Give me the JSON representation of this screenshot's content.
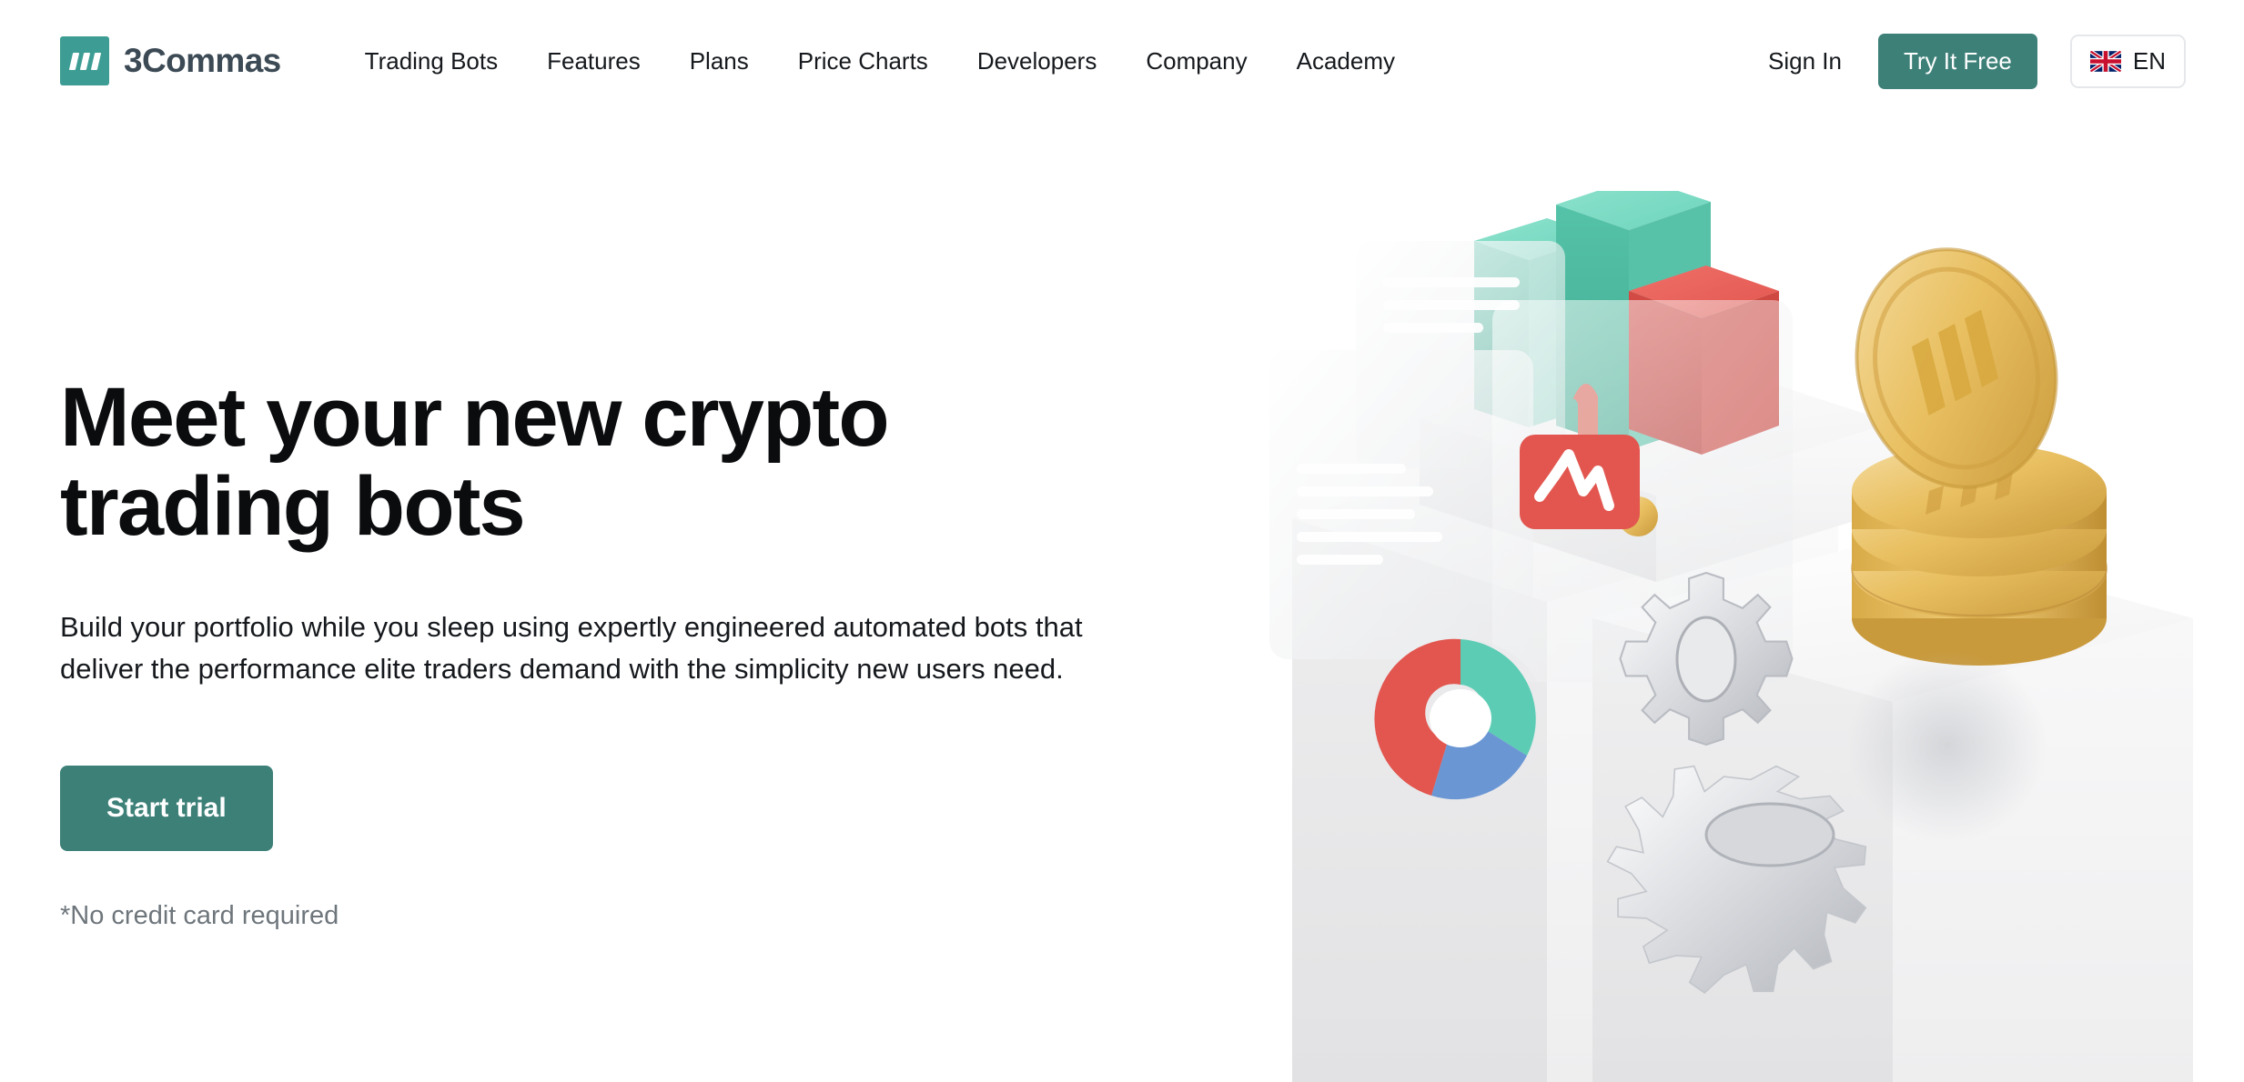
{
  "brand": {
    "name": "3Commas",
    "logo_icon": "three-commas-mark",
    "mark_color": "#3d9d94",
    "wordmark_color": "#3c4a55",
    "accent_color": "#3d8078"
  },
  "header": {
    "nav_items": [
      {
        "label": "Trading Bots"
      },
      {
        "label": "Features"
      },
      {
        "label": "Plans"
      },
      {
        "label": "Price Charts"
      },
      {
        "label": "Developers"
      },
      {
        "label": "Company"
      },
      {
        "label": "Academy"
      }
    ],
    "sign_in_label": "Sign In",
    "try_free_label": "Try It Free",
    "language": {
      "code": "EN",
      "flag_icon": "uk-flag-icon"
    }
  },
  "hero": {
    "title": "Meet your new crypto trading bots",
    "subtitle": "Build your portfolio while you sleep using expertly engineered automated bots that deliver the performance elite traders demand with the simplicity new users need.",
    "cta_label": "Start trial",
    "disclaimer": "*No credit card required"
  },
  "illustration": {
    "name": "crypto-trading-3d-illustration",
    "elements": [
      "teal-bar-medium",
      "teal-bar-tall",
      "red-cube",
      "gold-coin-stack",
      "donut-chart",
      "glass-card",
      "red-chart-badge",
      "silver-gears",
      "white-pedestals"
    ],
    "colors": {
      "teal_bar": "#6ed5bd",
      "teal_bar_shade": "#4cb89f",
      "red_cube": "#e2564f",
      "red_cube_shade": "#c4433d",
      "gold": "#e9c062",
      "gold_shade": "#d0a243",
      "donut_red": "#e2564f",
      "donut_teal": "#5cccb4",
      "donut_blue": "#6b96d4",
      "silver": "#d8dade",
      "pedestal": "#f6f6f7"
    }
  }
}
